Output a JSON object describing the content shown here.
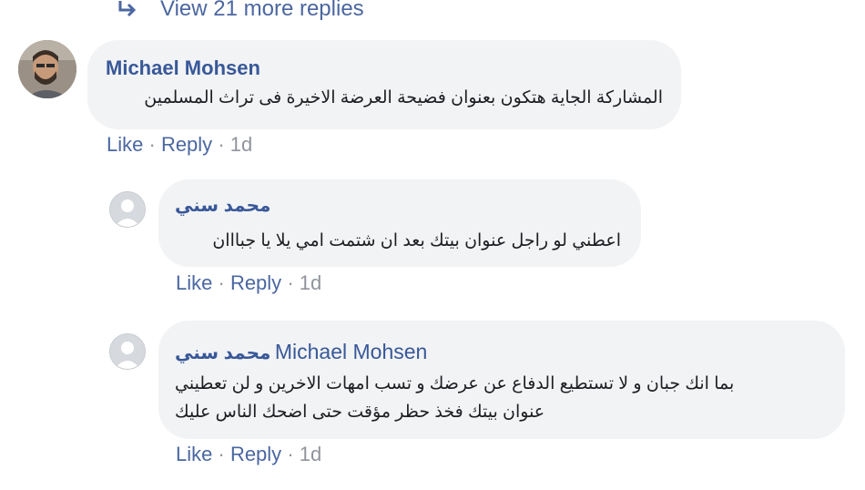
{
  "thread": {
    "view_more_label": "View 21 more replies",
    "accent_color": "#385898",
    "comments": [
      {
        "author": "Michael Mohsen",
        "text": "المشاركة الجاية هتكون بعنوان فضيحة العرضة الاخيرة فى تراث المسلمين",
        "like_label": "Like",
        "reply_label": "Reply",
        "separator": "·",
        "time": "1d"
      },
      {
        "author": "محمد سني",
        "text": "اعطني لو راجل عنوان بيتك بعد ان شتمت امي يلا يا جبااان",
        "like_label": "Like",
        "reply_label": "Reply",
        "separator": "·",
        "time": "1d"
      },
      {
        "author": "محمد سني",
        "mention": "Michael Mohsen",
        "text_line1": "بما انك جبان و لا تستطيع الدفاع عن عرضك و تسب امهات الاخرين و لن تعطيني",
        "text_line2": "عنوان بيتك فخذ حظر مؤقت حتى اضحك الناس عليك",
        "like_label": "Like",
        "reply_label": "Reply",
        "separator": "·",
        "time": "1d"
      }
    ]
  }
}
